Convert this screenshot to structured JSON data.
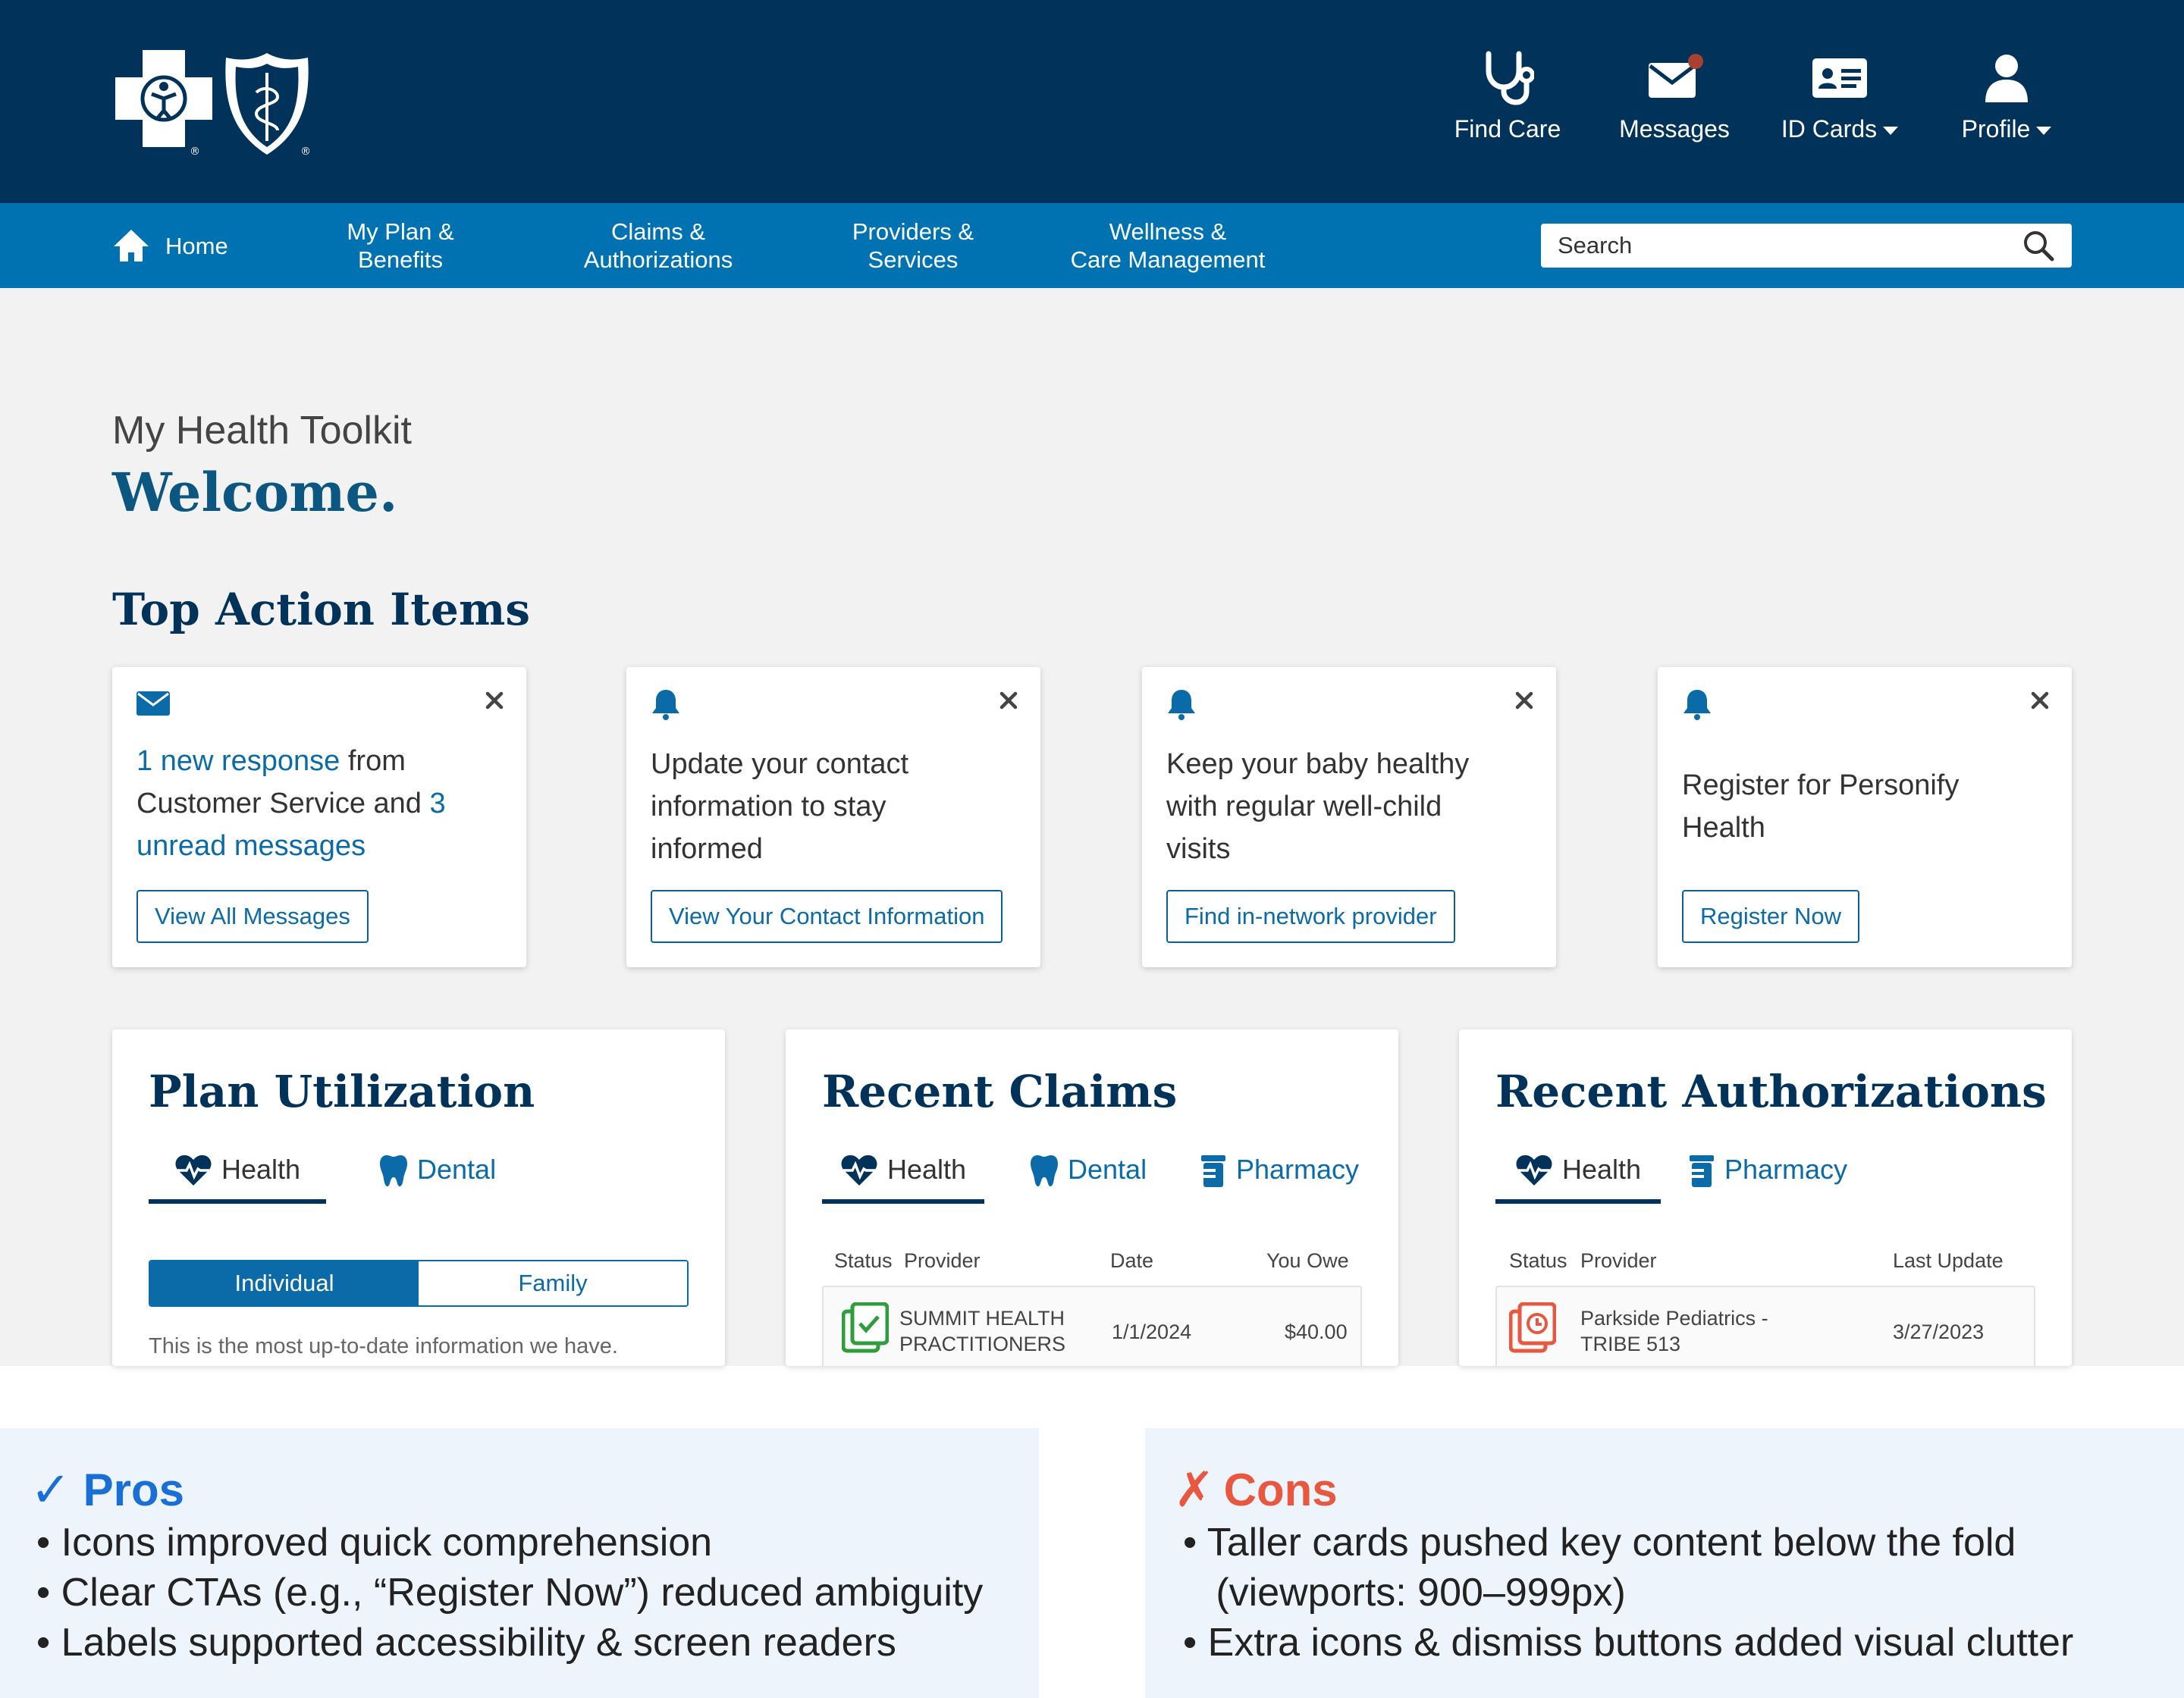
{
  "colors": {
    "navy": "#00325a",
    "nav_blue": "#0072b2",
    "link_blue": "#0b6aa8",
    "pros_blue": "#1a6fd6",
    "cons_red": "#e8573f",
    "claim_green": "#2e9d3c",
    "auth_red": "#e8573f",
    "badge": "#a8412f"
  },
  "header": {
    "utility": [
      {
        "label": "Find Care",
        "icon": "stethoscope-icon",
        "caret": false
      },
      {
        "label": "Messages",
        "icon": "envelope-icon",
        "caret": false
      },
      {
        "label": "ID Cards",
        "icon": "id-card-icon",
        "caret": true
      },
      {
        "label": "Profile",
        "icon": "user-icon",
        "caret": true
      }
    ]
  },
  "nav": {
    "home": "Home",
    "items": [
      {
        "line1": "My Plan &",
        "line2": "Benefits"
      },
      {
        "line1": "Claims &",
        "line2": "Authorizations"
      },
      {
        "line1": "Providers &",
        "line2": "Services"
      },
      {
        "line1": "Wellness &",
        "line2": "Care Management"
      }
    ],
    "search_placeholder": "Search"
  },
  "page": {
    "subtitle": "My Health Toolkit",
    "title": "Welcome.",
    "section_title": "Top Action Items"
  },
  "action_items": [
    {
      "icon": "envelope-icon",
      "text_link1": "1 new response",
      "text_mid": " from Customer Service and ",
      "text_link2": "3 unread messages",
      "button": "View All Messages"
    },
    {
      "icon": "bell-icon",
      "text": "Update your contact information to stay informed",
      "button": "View Your Contact Information"
    },
    {
      "icon": "bell-icon",
      "text": "Keep your baby healthy with regular well-child visits",
      "button": "Find in-network provider"
    },
    {
      "icon": "bell-icon",
      "text": "Register for Personify Health",
      "button": "Register Now"
    }
  ],
  "plan_utilization": {
    "title": "Plan Utilization",
    "tabs": [
      {
        "label": "Health",
        "icon": "heartbeat-icon"
      },
      {
        "label": "Dental",
        "icon": "tooth-icon"
      }
    ],
    "segment": [
      "Individual",
      "Family"
    ],
    "note": "This is the most up-to-date information we have."
  },
  "recent_claims": {
    "title": "Recent Claims",
    "tabs": [
      {
        "label": "Health",
        "icon": "heartbeat-icon"
      },
      {
        "label": "Dental",
        "icon": "tooth-icon"
      },
      {
        "label": "Pharmacy",
        "icon": "pill-bottle-icon"
      }
    ],
    "headers": [
      "Status",
      "Provider",
      "Date",
      "You Owe"
    ],
    "row": {
      "provider_line1": "SUMMIT HEALTH",
      "provider_line2": "PRACTITIONERS",
      "date": "1/1/2024",
      "owe": "$40.00"
    }
  },
  "recent_authorizations": {
    "title": "Recent Authorizations",
    "tabs": [
      {
        "label": "Health",
        "icon": "heartbeat-icon"
      },
      {
        "label": "Pharmacy",
        "icon": "pill-bottle-icon"
      }
    ],
    "headers": [
      "Status",
      "Provider",
      "Last Update"
    ],
    "row": {
      "provider_line1": "Parkside Pediatrics  -",
      "provider_line2": "TRIBE 513",
      "date": "3/27/2023"
    }
  },
  "pros": {
    "mark": "✓",
    "title": "Pros",
    "items": [
      "• Icons improved quick comprehension",
      "• Clear CTAs (e.g., “Register Now”) reduced ambiguity",
      "• Labels supported accessibility & screen readers"
    ]
  },
  "cons": {
    "mark": "✗",
    "title": "Cons",
    "items": [
      "• Taller cards pushed key content below the fold",
      "   (viewports: 900–999px)",
      "• Extra icons & dismiss buttons added visual clutter"
    ]
  }
}
